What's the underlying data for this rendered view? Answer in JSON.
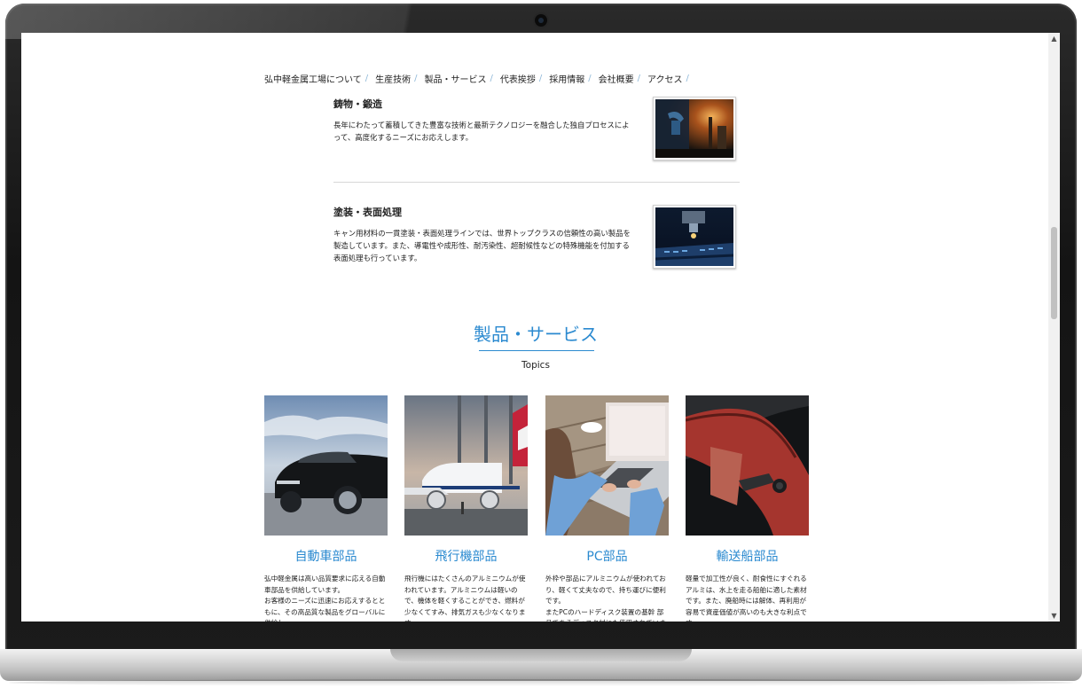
{
  "nav": {
    "items": [
      "弘中軽金属工場について",
      "生産技術",
      "製品・サービス",
      "代表挨拶",
      "採用情報",
      "会社概要",
      "アクセス"
    ],
    "separator": "/"
  },
  "tech": [
    {
      "title": "鋳物・鍛造",
      "desc": "長年にわたって蓄積してきた豊富な技術と最新テクノロジーを融合した独自プロセスによって、高度化するニーズにお応えします。"
    },
    {
      "title": "塗装・表面処理",
      "desc": "キャン用材料の一貫塗装・表面処理ラインでは、世界トップクラスの信頼性の高い製品を製造しています。また、導電性や成形性、耐汚染性、超耐候性などの特殊機能を付加する表面処理も行っています。"
    }
  ],
  "section": {
    "title": "製品・サービス",
    "subtitle": "Topics"
  },
  "products": [
    {
      "title": "自動車部品",
      "desc": "弘中軽金属は高い品質要求に応える自動車部品を供給しています。\nお客様のニーズに迅速にお応えするとともに、その高品質な製品をグローバルに供給し"
    },
    {
      "title": "飛行機部品",
      "desc": "飛行機にはたくさんのアルミニウムが使われています。アルミニウムは軽いので、機体を軽くすることができ、燃料が少なくてすみ、排気ガスも少なくなります。"
    },
    {
      "title": "PC部品",
      "desc": "外枠や部品にアルミニウムが使われており、軽くて丈夫なので、持ち運びに便利です。\nまたPCのハードディスク装置の基幹 部品であるディスク材にも使用されています。"
    },
    {
      "title": "輸送船部品",
      "desc": "軽量で加工性が良く、耐食性にすぐれるアルミは、水上を走る船舶に適した素材です。また、廃船時には解体、再利用が容易で資産価値が高いのも大きな利点です。"
    }
  ],
  "icons": {
    "scroll_up": "▲",
    "scroll_down": "▼"
  },
  "colors": {
    "accent": "#2b8ad0",
    "separator": "#8fb8d8"
  }
}
